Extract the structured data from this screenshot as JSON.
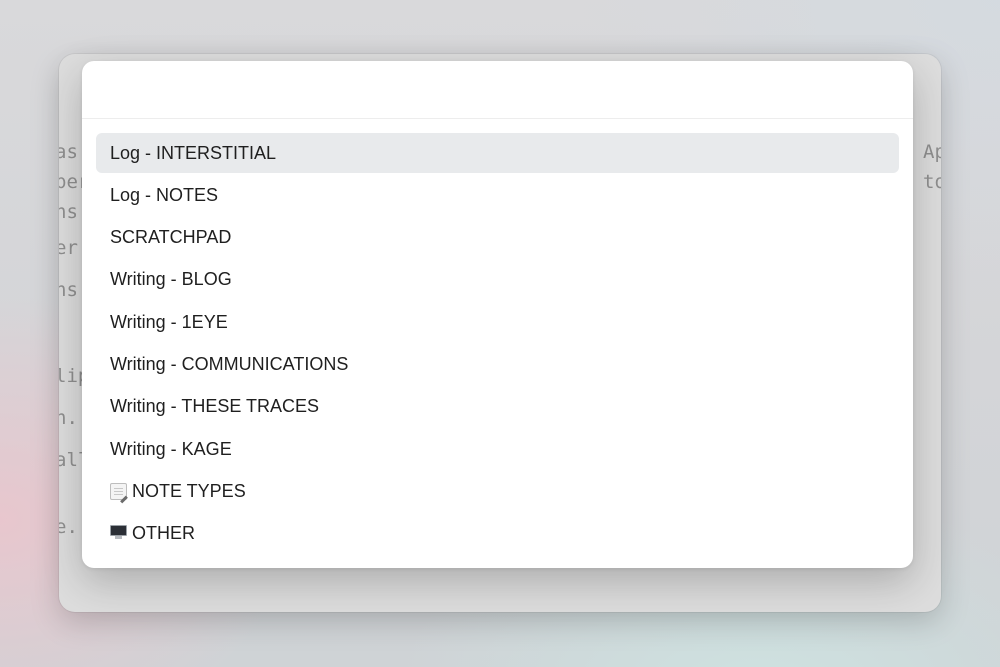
{
  "background": {
    "left_text_lines": [
      " as",
      "per",
      "ns",
      "er",
      "ns",
      "lip",
      "n.",
      "all",
      "e."
    ],
    "right_text_lines": [
      "Ap",
      "to"
    ]
  },
  "palette": {
    "search": {
      "value": "",
      "placeholder": ""
    },
    "items": [
      {
        "label": "Log - INTERSTITIAL",
        "icon": "",
        "selected": true
      },
      {
        "label": "Log - NOTES",
        "icon": ""
      },
      {
        "label": "SCRATCHPAD",
        "icon": ""
      },
      {
        "label": "Writing - BLOG",
        "icon": ""
      },
      {
        "label": "Writing - 1EYE",
        "icon": ""
      },
      {
        "label": "Writing - COMMUNICATIONS",
        "icon": ""
      },
      {
        "label": "Writing - THESE TRACES",
        "icon": ""
      },
      {
        "label": "Writing - KAGE",
        "icon": ""
      },
      {
        "label": "NOTE TYPES",
        "icon": "memo-icon"
      },
      {
        "label": "OTHER",
        "icon": "desktop-computer-icon"
      }
    ]
  },
  "colors": {
    "selected_row": "#e8eaec",
    "palette_bg": "#ffffff",
    "text": "#1f1f1f"
  }
}
